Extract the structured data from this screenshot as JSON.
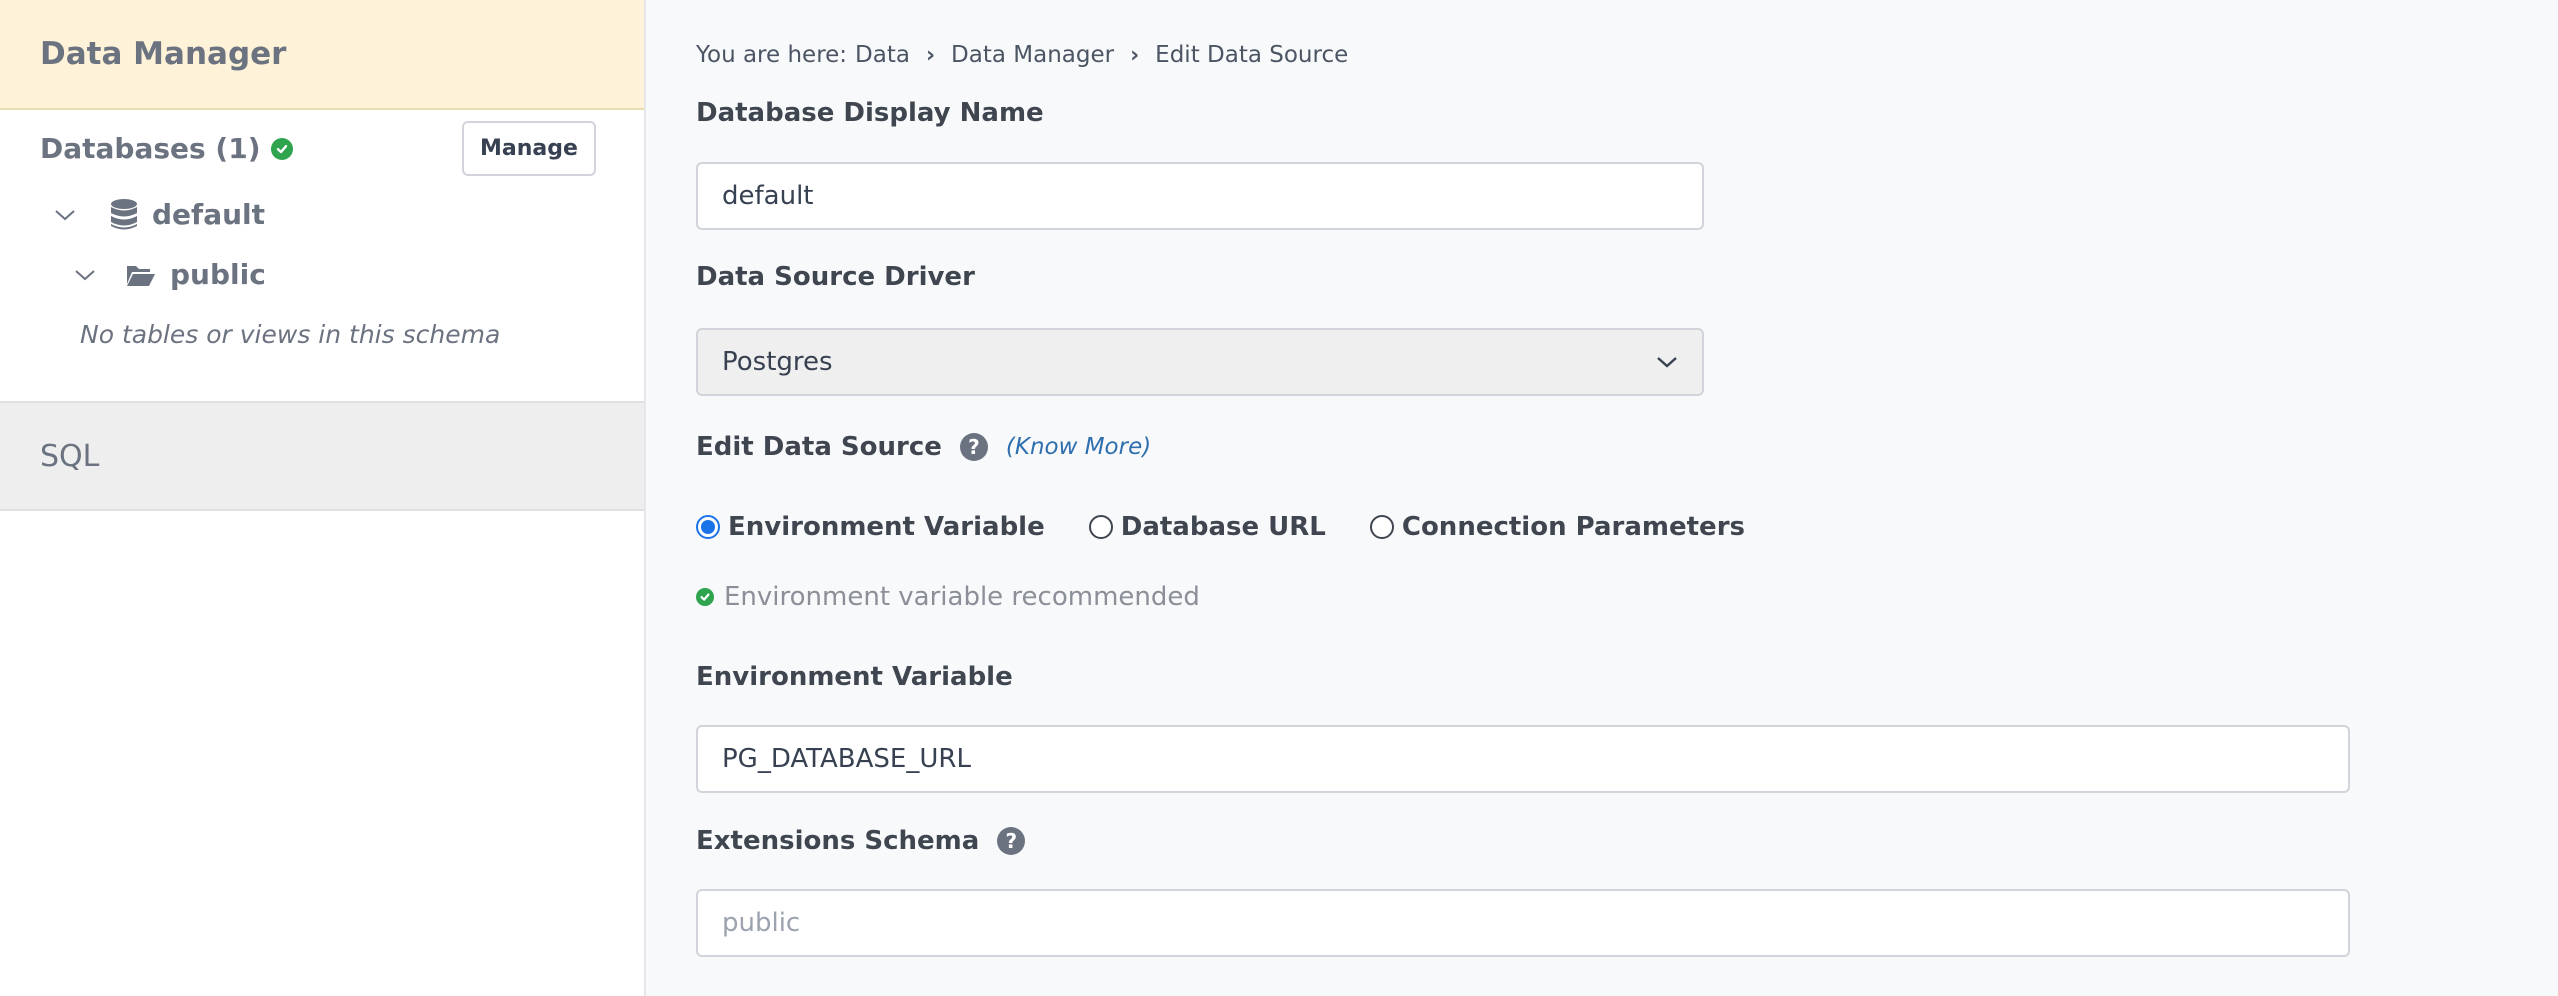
{
  "sidebar": {
    "title": "Data Manager",
    "databases_label": "Databases (1)",
    "manage_label": "Manage",
    "database_name": "default",
    "schema_name": "public",
    "empty_schema_message": "No tables or views in this schema",
    "sql_tab_label": "SQL"
  },
  "breadcrumb": {
    "prefix": "You are here:",
    "items": [
      "Data",
      "Data Manager",
      "Edit Data Source"
    ]
  },
  "form": {
    "display_name_label": "Database Display Name",
    "display_name_value": "default",
    "driver_label": "Data Source Driver",
    "driver_value": "Postgres",
    "edit_source_label": "Edit Data Source",
    "know_more_label": "(Know More)",
    "radio_options": [
      "Environment Variable",
      "Database URL",
      "Connection Parameters"
    ],
    "selected_option": "Environment Variable",
    "recommend_hint": "Environment variable recommended",
    "env_var_label": "Environment Variable",
    "env_var_value": "PG_DATABASE_URL",
    "extensions_label": "Extensions Schema",
    "extensions_placeholder": "public"
  },
  "colors": {
    "header_bg": "#fef3d8",
    "success": "#2ea44f",
    "link": "#2f6fae",
    "radio_selected": "#1a73e8"
  }
}
